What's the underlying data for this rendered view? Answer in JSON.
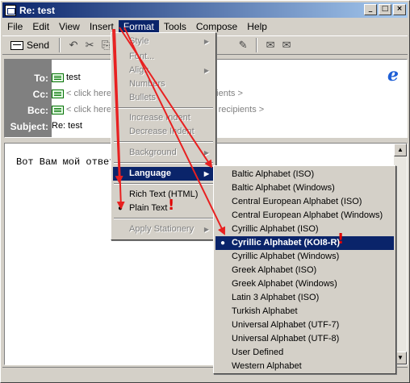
{
  "window": {
    "title": "Re: test"
  },
  "titlebar_buttons": [
    "_",
    "□",
    "×"
  ],
  "menubar": [
    {
      "label": "File",
      "key": "F"
    },
    {
      "label": "Edit",
      "key": "E"
    },
    {
      "label": "View",
      "key": "V"
    },
    {
      "label": "Insert",
      "key": "I"
    },
    {
      "label": "Format",
      "key": "o"
    },
    {
      "label": "Tools",
      "key": "T"
    },
    {
      "label": "Compose",
      "key": "C"
    },
    {
      "label": "Help",
      "key": "H"
    }
  ],
  "toolbar": {
    "send_label": "Send"
  },
  "header": {
    "to_label": "To:",
    "to_value": "test",
    "cc_label": "Cc:",
    "cc_placeholder": "< click here to enter carbon copy recipients >",
    "bcc_label": "Bcc:",
    "bcc_placeholder": "< click here to enter blind carbon copy recipients >",
    "subject_label": "Subject:",
    "subject_value": "Re: test"
  },
  "body": {
    "text": "Вот Вам мой ответ"
  },
  "format_menu": {
    "items": [
      {
        "label": "Style",
        "disabled": true,
        "submenu": true
      },
      {
        "label": "Font...",
        "disabled": true
      },
      {
        "label": "Align",
        "disabled": true,
        "submenu": true
      },
      {
        "label": "Numbers",
        "disabled": true
      },
      {
        "label": "Bullets",
        "disabled": true
      },
      {
        "label": "Increase Indent",
        "disabled": true
      },
      {
        "label": "Decrease Indent",
        "disabled": true
      },
      {
        "label": "Background",
        "disabled": true,
        "submenu": true
      },
      {
        "label": "Language",
        "disabled": false,
        "submenu": true,
        "highlighted": true
      },
      {
        "label": "Rich Text (HTML)",
        "disabled": false
      },
      {
        "label": "Plain Text",
        "disabled": false,
        "checked": true
      },
      {
        "label": "Apply Stationery",
        "disabled": true,
        "submenu": true
      }
    ]
  },
  "language_menu": {
    "items": [
      "Baltic Alphabet (ISO)",
      "Baltic Alphabet (Windows)",
      "Central European Alphabet (ISO)",
      "Central European Alphabet (Windows)",
      "Cyrillic Alphabet (ISO)",
      "Cyrillic Alphabet (KOI8-R)",
      "Cyrillic Alphabet (Windows)",
      "Greek Alphabet (ISO)",
      "Greek Alphabet (Windows)",
      "Latin 3 Alphabet (ISO)",
      "Turkish Alphabet",
      "Universal Alphabet (UTF-7)",
      "Universal Alphabet (UTF-8)",
      "User Defined",
      "Western Alphabet"
    ],
    "selected": "Cyrillic Alphabet (KOI8-R)"
  },
  "annotation": {
    "mark": "!",
    "color": "#e00000"
  }
}
